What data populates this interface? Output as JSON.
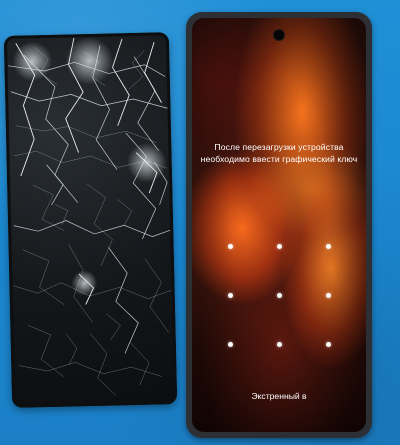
{
  "scene": {
    "background_color": "#1f8fd6"
  },
  "broken_screen": {
    "color": "#111416",
    "crack_color": "#e1e8ec"
  },
  "phone": {
    "lock_screen": {
      "message_line1": "После перезагрузки устройства",
      "message_line2": "необходимо ввести графический ключ",
      "pattern_dot_count": 9,
      "emergency_label": "Экстренный в"
    }
  }
}
